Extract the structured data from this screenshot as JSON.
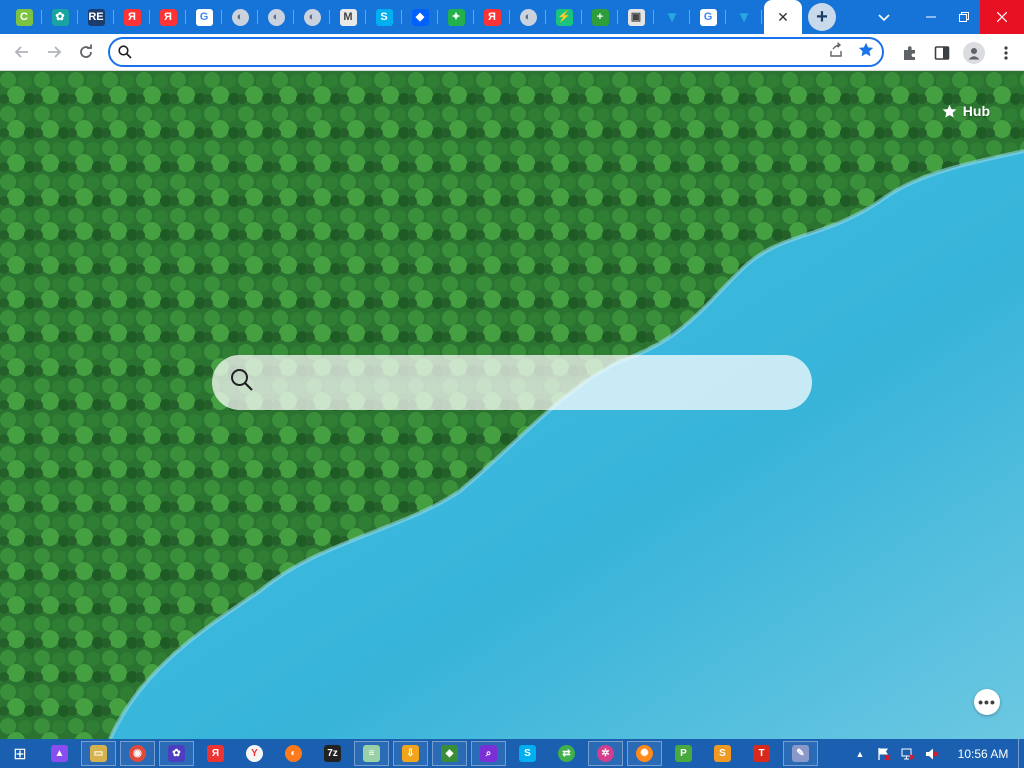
{
  "browser": {
    "tabs": [
      {
        "icon": "green-c-icon",
        "glyph": "C",
        "color": "#7cc243"
      },
      {
        "icon": "gear-teal-icon",
        "glyph": "✿",
        "color": "#1aa3a3"
      },
      {
        "icon": "re-icon",
        "glyph": "RE",
        "color": "#1d3c6e"
      },
      {
        "icon": "yandex-icon",
        "glyph": "Я",
        "color": "#f33"
      },
      {
        "icon": "yandex-icon",
        "glyph": "Я",
        "color": "#f33"
      },
      {
        "icon": "google-icon",
        "glyph": "G",
        "color": "#ffffff"
      },
      {
        "icon": "globe-icon",
        "glyph": "◐",
        "color": "#7a8aa0"
      },
      {
        "icon": "globe-icon",
        "glyph": "◐",
        "color": "#7a8aa0"
      },
      {
        "icon": "globe-icon",
        "glyph": "◐",
        "color": "#7a8aa0"
      },
      {
        "icon": "m-icon",
        "glyph": "M",
        "color": "#e8e8e8"
      },
      {
        "icon": "skype-icon",
        "glyph": "S",
        "color": "#00aff0"
      },
      {
        "icon": "dropbox-icon",
        "glyph": "◆",
        "color": "#0061ff"
      },
      {
        "icon": "green-star-icon",
        "glyph": "✦",
        "color": "#22b14c"
      },
      {
        "icon": "yandex-icon",
        "glyph": "Я",
        "color": "#f33"
      },
      {
        "icon": "globe-icon",
        "glyph": "◐",
        "color": "#7a8aa0"
      },
      {
        "icon": "bolt-icon",
        "glyph": "⚡",
        "color": "#19c37d"
      },
      {
        "icon": "plus-circle-icon",
        "glyph": "+",
        "color": "#2e9e3a"
      },
      {
        "icon": "screen-icon",
        "glyph": "▣",
        "color": "#e4e4e4"
      },
      {
        "icon": "bookmark-icon",
        "glyph": "▼",
        "color": "#2aa9e0"
      },
      {
        "icon": "google-icon",
        "glyph": "G",
        "color": "#ffffff"
      },
      {
        "icon": "bookmark-icon",
        "glyph": "▼",
        "color": "#2aa9e0"
      }
    ],
    "active_tab_close": "✕",
    "new_tab": "+"
  },
  "toolbar": {
    "address_value": "",
    "address_placeholder": ""
  },
  "page": {
    "hub_label": "Hub",
    "search_placeholder": "",
    "more_label": "•••"
  },
  "taskbar": {
    "apps": [
      {
        "icon": "windows-start-icon",
        "glyph": "⊞",
        "color": "transparent"
      },
      {
        "icon": "launcher-icon",
        "glyph": "▲",
        "color": "#8a4df0"
      },
      {
        "icon": "file-explorer-icon",
        "glyph": "▭",
        "color": "#d6b24c"
      },
      {
        "icon": "chrome-icon",
        "glyph": "◉",
        "color": "#e04a3a"
      },
      {
        "icon": "settings-icon",
        "glyph": "✿",
        "color": "#4b3fbf"
      },
      {
        "icon": "yandex-icon",
        "glyph": "Я",
        "color": "#e33"
      },
      {
        "icon": "yandex-browser-icon",
        "glyph": "Y",
        "color": "#f5f5f5"
      },
      {
        "icon": "firefox-icon",
        "glyph": "◐",
        "color": "#ff7a1a"
      },
      {
        "icon": "7zip-icon",
        "glyph": "7z",
        "color": "#222222"
      },
      {
        "icon": "notepad-icon",
        "glyph": "≡",
        "color": "#9ad0a8"
      },
      {
        "icon": "download-icon",
        "glyph": "⇩",
        "color": "#f2a51a"
      },
      {
        "icon": "network-map-icon",
        "glyph": "◆",
        "color": "#3a8e3a"
      },
      {
        "icon": "search-app-icon",
        "glyph": "⌕",
        "color": "#7b2fd6"
      },
      {
        "icon": "skype-icon",
        "glyph": "S",
        "color": "#00aff0"
      },
      {
        "icon": "sync-icon",
        "glyph": "⇄",
        "color": "#3fb04b"
      },
      {
        "icon": "color-wheel-icon",
        "glyph": "✲",
        "color": "#d23f8e"
      },
      {
        "icon": "pinwheel-icon",
        "glyph": "✺",
        "color": "#ff8a1a"
      },
      {
        "icon": "p-app-icon",
        "glyph": "P",
        "color": "#49a83e"
      },
      {
        "icon": "s-app-icon",
        "glyph": "S",
        "color": "#f19a23"
      },
      {
        "icon": "t-app-icon",
        "glyph": "T",
        "color": "#d9291c"
      },
      {
        "icon": "pen-app-icon",
        "glyph": "✎",
        "color": "#8a99c9"
      }
    ],
    "tray": {
      "chevron": "▲",
      "flag_glyph": "⚑",
      "network_glyph": "▣",
      "volume_glyph": "🔈"
    },
    "clock": "10:56 AM"
  },
  "colors": {
    "titlebar": "#1673d8",
    "omnibox_border": "#1a73e8",
    "lake": "#3ab8dc",
    "forest": "#2f7d33",
    "taskbar": "#1a5fb0",
    "close_button": "#e81123"
  }
}
